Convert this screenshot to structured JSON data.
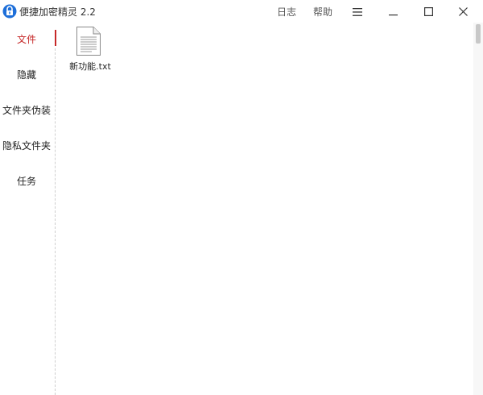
{
  "app": {
    "title": "便捷加密精灵 2.2"
  },
  "header": {
    "log_label": "日志",
    "help_label": "帮助"
  },
  "sidebar": {
    "items": [
      {
        "label": "文件",
        "active": true
      },
      {
        "label": "隐藏",
        "active": false
      },
      {
        "label": "文件夹伪装",
        "active": false
      },
      {
        "label": "隐私文件夹",
        "active": false
      },
      {
        "label": "任务",
        "active": false
      }
    ]
  },
  "files": [
    {
      "name": "新功能.txt",
      "icon": "text-file-icon"
    }
  ],
  "colors": {
    "accent": "#c62828",
    "logo": "#1e6fd9"
  },
  "icons": {
    "app": "lock-logo-icon",
    "menu": "hamburger-menu-icon",
    "minimize": "minimize-icon",
    "maximize": "maximize-icon",
    "close": "close-icon"
  }
}
